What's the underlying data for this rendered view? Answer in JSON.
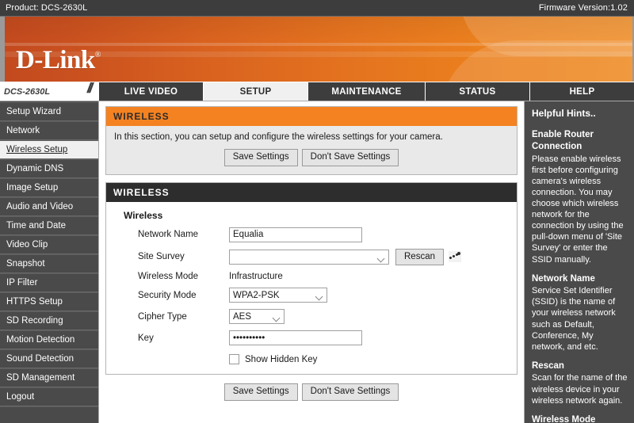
{
  "topbar": {
    "product": "Product: DCS-2630L",
    "firmware": "Firmware Version:1.02"
  },
  "brand": {
    "logo_text": "D-Link",
    "registered_mark": "®"
  },
  "nav": {
    "model": "DCS-2630L",
    "tabs": [
      {
        "label": "LIVE VIDEO",
        "active": false
      },
      {
        "label": "SETUP",
        "active": true
      },
      {
        "label": "MAINTENANCE",
        "active": false
      },
      {
        "label": "STATUS",
        "active": false
      },
      {
        "label": "HELP",
        "active": false
      }
    ]
  },
  "sidebar": {
    "items": [
      {
        "label": "Setup Wizard",
        "active": false
      },
      {
        "label": "Network",
        "active": false
      },
      {
        "label": "Wireless Setup",
        "active": true
      },
      {
        "label": "Dynamic DNS",
        "active": false
      },
      {
        "label": "Image Setup",
        "active": false
      },
      {
        "label": "Audio and Video",
        "active": false
      },
      {
        "label": "Time and Date",
        "active": false
      },
      {
        "label": "Video Clip",
        "active": false
      },
      {
        "label": "Snapshot",
        "active": false
      },
      {
        "label": "IP Filter",
        "active": false
      },
      {
        "label": "HTTPS Setup",
        "active": false
      },
      {
        "label": "SD Recording",
        "active": false
      },
      {
        "label": "Motion Detection",
        "active": false
      },
      {
        "label": "Sound Detection",
        "active": false
      },
      {
        "label": "SD Management",
        "active": false
      },
      {
        "label": "Logout",
        "active": false
      }
    ]
  },
  "intro_panel": {
    "header": "WIRELESS",
    "description": "In this section, you can setup and configure the wireless settings for your camera.",
    "save_label": "Save Settings",
    "dont_save_label": "Don't Save Settings"
  },
  "form_panel": {
    "header": "WIRELESS",
    "group_title": "Wireless",
    "fields": {
      "network_name": {
        "label": "Network Name",
        "value": "Equalia",
        "placeholder": ""
      },
      "site_survey": {
        "label": "Site Survey",
        "value": "",
        "rescan_label": "Rescan",
        "rescan_icon": "spinner-icon"
      },
      "wireless_mode": {
        "label": "Wireless Mode",
        "value": "Infrastructure"
      },
      "security_mode": {
        "label": "Security Mode",
        "value": "WPA2-PSK"
      },
      "cipher_type": {
        "label": "Cipher Type",
        "value": "AES"
      },
      "key": {
        "label": "Key",
        "value": "••••••••••"
      },
      "show_hidden_key": {
        "label": "Show Hidden Key",
        "checked": false
      }
    },
    "save_label": "Save Settings",
    "dont_save_label": "Don't Save Settings"
  },
  "hints": {
    "title": "Helpful Hints..",
    "sections": [
      {
        "heading": "Enable Router Connection",
        "body": "Please enable wireless first before configuring camera's wireless connection. You may choose which wireless network for the connection by using the pull-down menu of 'Site Survey' or enter the SSID manually."
      },
      {
        "heading": "Network Name",
        "body": "Service Set Identifier (SSID) is the name of your wireless network such as Default, Conference, My network, and etc."
      },
      {
        "heading": "Rescan",
        "body": "Scan for the name of the wireless device in your wireless network again."
      },
      {
        "heading": "Wireless Mode",
        "body": ""
      }
    ]
  },
  "colors": {
    "brand_orange": "#f58220",
    "banner_left": "#c34a1e",
    "banner_right": "#ee8a22",
    "dark_panel": "#2d2d2d",
    "sidebar_bg": "#4a4a4a",
    "topbar_bg": "#3d3d3d"
  }
}
